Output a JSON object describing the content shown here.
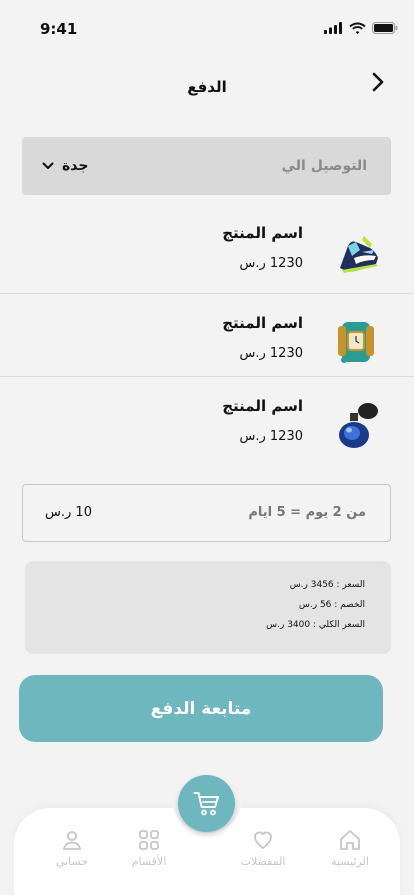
{
  "status_bar": {
    "time": "9:41"
  },
  "header": {
    "title": "الدفع"
  },
  "delivery": {
    "label": "التوصيل الي",
    "value": "جدة"
  },
  "products": [
    {
      "name": "اسم المنتج",
      "price": "1230 ر.س",
      "image": "sneaker-image"
    },
    {
      "name": "اسم المنتج",
      "price": "1230 ر.س",
      "image": "watch-image"
    },
    {
      "name": "اسم المنتج",
      "price": "1230 ر.س",
      "image": "perfume-image"
    }
  ],
  "shipping": {
    "duration": "من 2 يوم = 5 ايام",
    "cost": "10 ر.س"
  },
  "summary": {
    "price": "السعر : 3456 ر.س",
    "discount": "الخصم : 56 ر.س",
    "total": "السعر الكلي : 3400 ر.س"
  },
  "checkout_label": "متابعة الدفع",
  "nav": {
    "home": "الرئيسية",
    "favorites": "المفضلات",
    "categories": "الأقسام",
    "account": "حسابي"
  },
  "colors": {
    "accent": "#6eb7be",
    "background": "#f3f3f3",
    "nav_inactive": "#c6c6c6"
  },
  "icons": [
    "signal-icon",
    "wifi-icon",
    "battery-icon",
    "chevron-right-icon",
    "chevron-down-icon",
    "cart-icon",
    "home-icon",
    "heart-icon",
    "grid-icon",
    "user-icon"
  ]
}
